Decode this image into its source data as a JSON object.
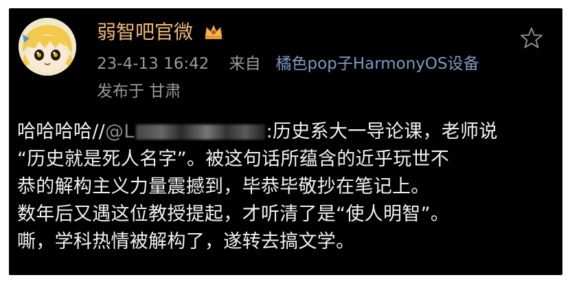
{
  "post": {
    "author": "弱智吧官微",
    "date": "23-4-13 16:42",
    "from_label": "来自",
    "source": "橘色pop子HarmonyOS设备",
    "location": "发布于 甘肃",
    "text": {
      "line1_prefix": "哈哈哈哈//",
      "mention_visible": "@L",
      "line1_suffix": ":历史系大一导论课，老师说",
      "line2": "“历史就是死人名字”。被这句话所蕴含的近乎玩世不",
      "line3": "恭的解构主义力量震撼到，毕恭毕敬抄在笔记上。",
      "line4": "数年后又遇这位教授提起，才听清了是“使人明智”。",
      "line5": "嘶，学科热情被解构了，遂转去搞文学。"
    }
  },
  "icons": {
    "verified": "crown-badge-icon",
    "favorite": "star-outline-icon",
    "avatar": "anime-girl-avatar"
  },
  "colors": {
    "background": "#000000",
    "author": "#f0b87a",
    "meta": "#9a9a9a",
    "source_link": "#7c9bc4",
    "body_text": "#f2f2f2"
  }
}
